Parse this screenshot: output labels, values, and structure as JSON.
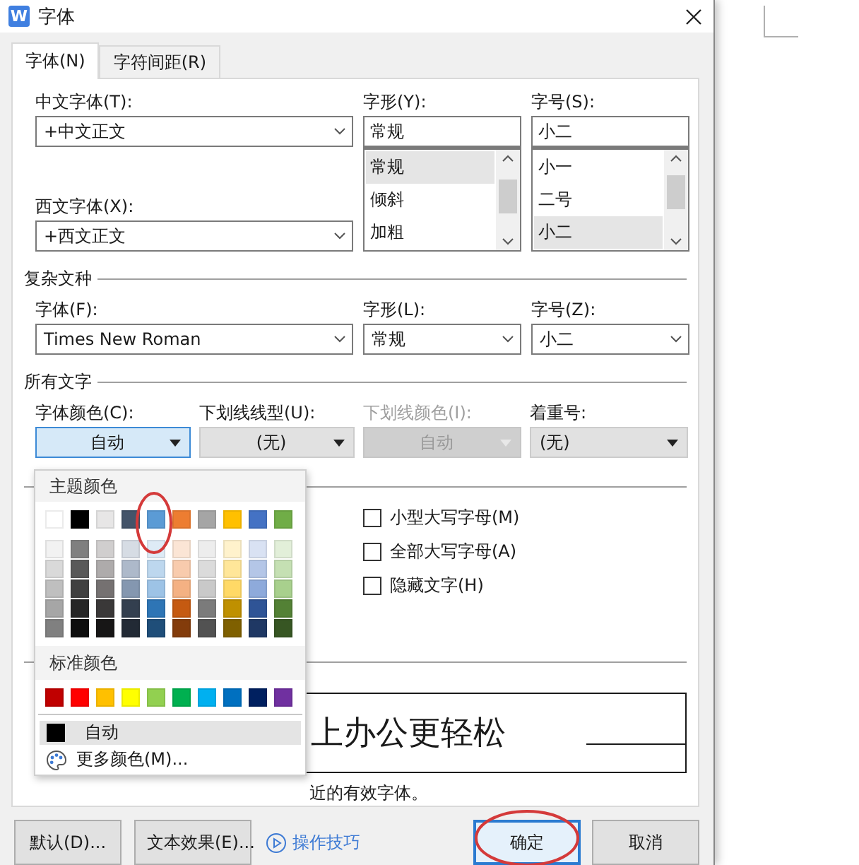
{
  "window": {
    "icon_letter": "W",
    "title": "字体"
  },
  "tabs": [
    {
      "label": "字体(N)",
      "selected": true
    },
    {
      "label": "字符间距(R)",
      "selected": false
    }
  ],
  "chinese_font": {
    "label": "中文字体(T):",
    "value": "+中文正文"
  },
  "western_font": {
    "label": "西文字体(X):",
    "value": "+西文正文"
  },
  "style": {
    "label": "字形(Y):",
    "value": "常规",
    "options": [
      {
        "label": "常规",
        "selected": true
      },
      {
        "label": "倾斜",
        "selected": false
      },
      {
        "label": "加粗",
        "selected": false
      }
    ]
  },
  "size": {
    "label": "字号(S):",
    "value": "小二",
    "options": [
      {
        "label": "小一",
        "selected": false
      },
      {
        "label": "二号",
        "selected": false
      },
      {
        "label": "小二",
        "selected": true
      }
    ]
  },
  "complex_script": {
    "title": "复杂文种",
    "font": {
      "label": "字体(F):",
      "value": "Times New Roman"
    },
    "style": {
      "label": "字形(L):",
      "value": "常规"
    },
    "size": {
      "label": "字号(Z):",
      "value": "小二"
    }
  },
  "all_text": {
    "title": "所有文字",
    "fields": [
      {
        "label": "字体颜色(C):",
        "value": "自动",
        "kind": "picker",
        "disabled": false,
        "open": true
      },
      {
        "label": "下划线线型(U):",
        "value": "(无)",
        "kind": "picker",
        "disabled": false,
        "open": false
      },
      {
        "label": "下划线颜色(I):",
        "value": "自动",
        "kind": "picker",
        "disabled": true,
        "open": false
      },
      {
        "label": "着重号:",
        "value": "(无)",
        "kind": "select",
        "disabled": false,
        "open": false
      }
    ]
  },
  "effects": {
    "checkboxes": [
      {
        "label": "小型大写字母(M)",
        "checked": false
      },
      {
        "label": "全部大写字母(A)",
        "checked": false
      },
      {
        "label": "隐藏文字(H)",
        "checked": false
      }
    ]
  },
  "preview": {
    "sample": "上办公更轻松",
    "note": "近的有效字体。"
  },
  "buttons": [
    {
      "label": "默认(D)...",
      "kind": "button",
      "focused": false
    },
    {
      "label": "文本效果(E)...",
      "kind": "button",
      "focused": false
    },
    {
      "label": "操作技巧",
      "kind": "link"
    },
    {
      "label": "确定",
      "kind": "button",
      "focused": true
    },
    {
      "label": "取消",
      "kind": "button",
      "focused": false
    }
  ],
  "color_menu": {
    "theme_title": "主题颜色",
    "theme_colors": [
      {
        "color": "#ffffff",
        "shades": [
          {
            "color": "#f2f2f2"
          },
          {
            "color": "#d9d9d9"
          },
          {
            "color": "#bfbfbf"
          },
          {
            "color": "#a6a6a6"
          },
          {
            "color": "#808080"
          }
        ]
      },
      {
        "color": "#000000",
        "shades": [
          {
            "color": "#7f7f7f"
          },
          {
            "color": "#595959"
          },
          {
            "color": "#404040"
          },
          {
            "color": "#262626"
          },
          {
            "color": "#0d0d0d"
          }
        ]
      },
      {
        "color": "#e7e6e6",
        "shades": [
          {
            "color": "#d0cece"
          },
          {
            "color": "#aeabab"
          },
          {
            "color": "#757171"
          },
          {
            "color": "#3a3838"
          },
          {
            "color": "#171616"
          }
        ]
      },
      {
        "color": "#44546a",
        "shades": [
          {
            "color": "#d6dce4"
          },
          {
            "color": "#adb9ca"
          },
          {
            "color": "#8497b0"
          },
          {
            "color": "#333f4f"
          },
          {
            "color": "#222a35"
          }
        ]
      },
      {
        "color": "#5b9bd5",
        "shades": [
          {
            "color": "#deebf6"
          },
          {
            "color": "#bdd7ee"
          },
          {
            "color": "#9dc3e6"
          },
          {
            "color": "#2e75b5"
          },
          {
            "color": "#1f4e79"
          }
        ]
      },
      {
        "color": "#ed7d31",
        "shades": [
          {
            "color": "#fbe5d5"
          },
          {
            "color": "#f8cbad"
          },
          {
            "color": "#f4b183"
          },
          {
            "color": "#c55a11"
          },
          {
            "color": "#833c0b"
          }
        ]
      },
      {
        "color": "#a5a5a5",
        "shades": [
          {
            "color": "#ededed"
          },
          {
            "color": "#dbdbdb"
          },
          {
            "color": "#c9c9c9"
          },
          {
            "color": "#7b7b7b"
          },
          {
            "color": "#525252"
          }
        ]
      },
      {
        "color": "#ffc000",
        "shades": [
          {
            "color": "#fff2cc"
          },
          {
            "color": "#ffe699"
          },
          {
            "color": "#ffd966"
          },
          {
            "color": "#bf9000"
          },
          {
            "color": "#7f6000"
          }
        ]
      },
      {
        "color": "#4472c4",
        "shades": [
          {
            "color": "#d9e2f3"
          },
          {
            "color": "#b4c6e7"
          },
          {
            "color": "#8eaadb"
          },
          {
            "color": "#2f5496"
          },
          {
            "color": "#1f3864"
          }
        ]
      },
      {
        "color": "#70ad47",
        "shades": [
          {
            "color": "#e2efd9"
          },
          {
            "color": "#c5e0b3"
          },
          {
            "color": "#a8d08d"
          },
          {
            "color": "#538135"
          },
          {
            "color": "#375623"
          }
        ]
      }
    ],
    "standard_title": "标准颜色",
    "standard_colors": [
      {
        "color": "#c00000"
      },
      {
        "color": "#ff0000"
      },
      {
        "color": "#ffc000"
      },
      {
        "color": "#ffff00"
      },
      {
        "color": "#92d050"
      },
      {
        "color": "#00b050"
      },
      {
        "color": "#00b0f0"
      },
      {
        "color": "#0070c0"
      },
      {
        "color": "#002060"
      },
      {
        "color": "#7030a0"
      }
    ],
    "automatic": {
      "label": "自动",
      "color": "#000000"
    },
    "more": "更多颜色(M)..."
  }
}
